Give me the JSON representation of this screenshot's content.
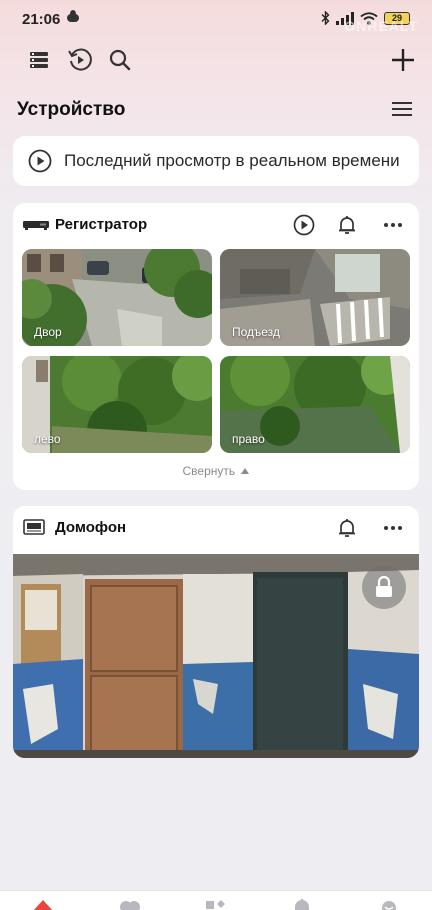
{
  "status_bar": {
    "time": "21:06",
    "battery": "29"
  },
  "watermark": "ONREALT",
  "toolbar": {
    "title": "Устройство"
  },
  "live_banner": {
    "label": "Последний просмотр в реальном времени"
  },
  "recorder": {
    "name": "Регистратор",
    "cameras": [
      {
        "label": "Двор"
      },
      {
        "label": "Подъезд"
      },
      {
        "label": "лево"
      },
      {
        "label": "право"
      }
    ],
    "collapse_label": "Свернуть"
  },
  "intercom": {
    "name": "Домофон"
  },
  "colors": {
    "accent": "#e8453c",
    "card_bg": "#ffffff",
    "page_bg": "#eeeef2"
  },
  "icons": [
    "list-icon",
    "playback-icon",
    "search-icon",
    "add-icon",
    "menu-icon",
    "play-icon",
    "bell-icon",
    "more-icon",
    "lock-icon",
    "recorder-icon",
    "intercom-icon"
  ]
}
